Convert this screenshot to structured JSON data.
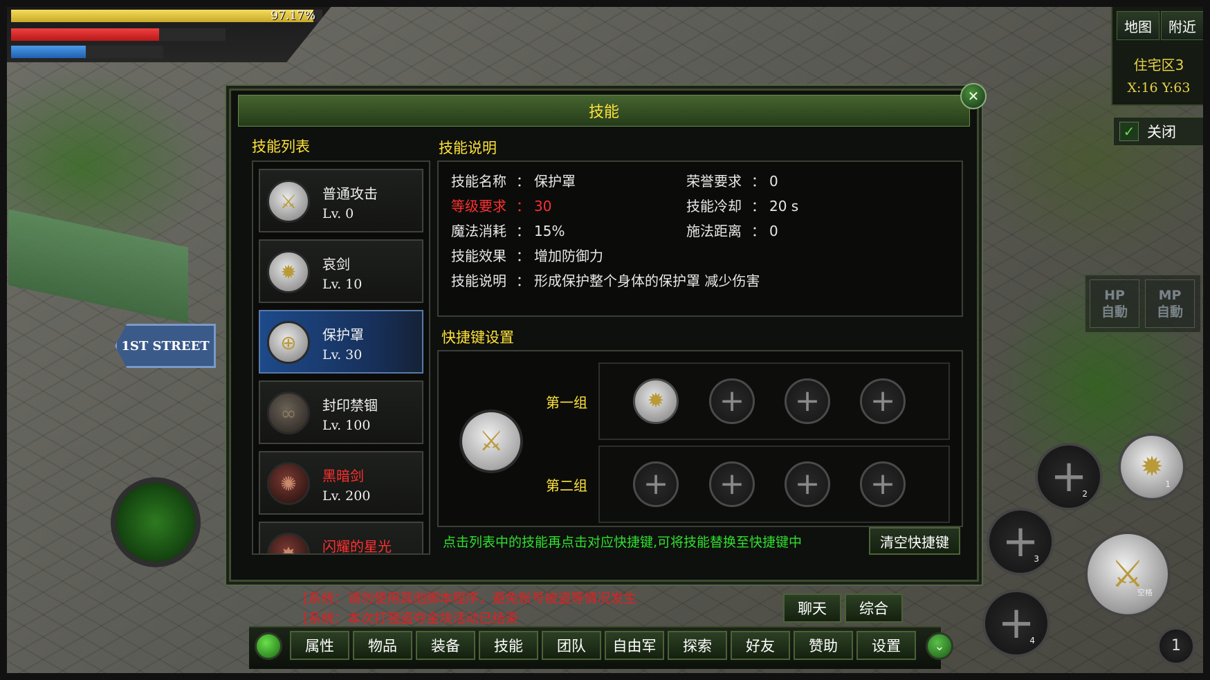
{
  "status": {
    "exp_percent_text": "97.17%",
    "exp_fill": 0.97,
    "hp_fill": 0.69,
    "mp_fill": 0.49
  },
  "map": {
    "btn_map": "地图",
    "btn_nearby": "附近",
    "area": "住宅区3",
    "coords": "X:16 Y:63",
    "toggle_label": "关闭"
  },
  "auto": {
    "hp": "HP自动",
    "mp": "MP自动",
    "hp_top": "HP",
    "hp_bottom": "自動",
    "mp_top": "MP",
    "mp_bottom": "自動"
  },
  "window": {
    "title": "技能",
    "list_label": "技能列表",
    "desc_label": "技能说明",
    "hotkey_label": "快捷键设置",
    "skills": [
      {
        "name": "普通攻击",
        "level": "Lv.  0",
        "icon": "sword-icon",
        "red": false
      },
      {
        "name": "哀剑",
        "level": "Lv.  10",
        "icon": "spiked-shield-icon",
        "red": false
      },
      {
        "name": "保护罩",
        "level": "Lv.  30",
        "icon": "globe-shield-icon",
        "red": false,
        "selected": true
      },
      {
        "name": "封印禁锢",
        "level": "Lv.  100",
        "icon": "chain-seal-icon",
        "red": false
      },
      {
        "name": "黑暗剑",
        "level": "Lv.  200",
        "icon": "dark-tentacle-icon",
        "red": true
      },
      {
        "name": "闪耀的星光",
        "level": "",
        "icon": "star-burst-icon",
        "red": true
      }
    ],
    "detail": {
      "name_key": "技能名称",
      "name_val": "保护罩",
      "honor_key": "荣誉要求",
      "honor_val": "0",
      "level_key": "等级要求",
      "level_val": "30",
      "cooldown_key": "技能冷却",
      "cooldown_val": "20 s",
      "mana_key": "魔法消耗",
      "mana_val": "15%",
      "range_key": "施法距离",
      "range_val": "0",
      "effect_key": "技能效果",
      "effect_val": "增加防御力",
      "desc_key": "技能说明",
      "desc_val": "形成保护整个身体的保护罩 减少伤害",
      "sep": "："
    },
    "group1_label": "第一组",
    "group2_label": "第二组",
    "hint": "点击列表中的技能再点击对应快捷键,可将技能替换至快捷键中",
    "clear_button": "清空快捷键"
  },
  "system_messages": [
    "[系统：请勿使用其他脚本程序，避免账号被盗等情况发生",
    "[系统：本次打强盗夺金块活动已结束"
  ],
  "chat_tabs": [
    "聊天",
    "综合"
  ],
  "menu": [
    "属性",
    "物品",
    "装备",
    "技能",
    "团队",
    "自由军",
    "探索",
    "好友",
    "赞助",
    "设置"
  ],
  "action_buttons": {
    "slot1": "1",
    "slot2": "2",
    "slot3": "3",
    "slot4": "4",
    "main_label": "空格",
    "corner": "1"
  },
  "street_sign": "1ST STREET"
}
